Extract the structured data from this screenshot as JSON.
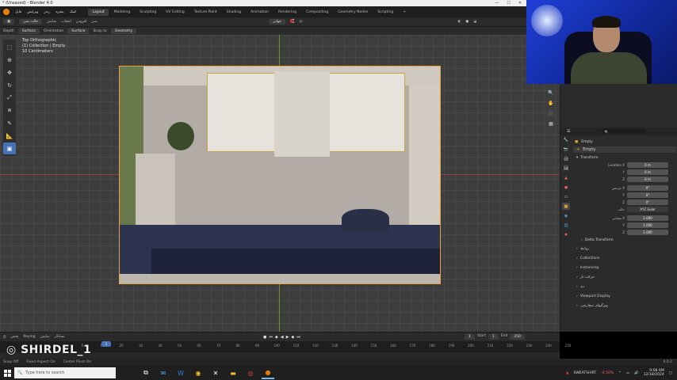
{
  "window": {
    "title": "* (Unsaved) - Blender 4.0",
    "controls": [
      "—",
      "☐",
      "✕"
    ]
  },
  "menubar": {
    "items": [
      "فایل",
      "ویرایش",
      "رندر",
      "پنجره",
      "کمک"
    ],
    "tabs": [
      "Layout",
      "Modeling",
      "Sculpting",
      "UV Editing",
      "Texture Paint",
      "Shading",
      "Animation",
      "Rendering",
      "Compositing",
      "Geometry Nodes",
      "Scripting",
      "+"
    ],
    "active_tab": "Layout"
  },
  "header": {
    "mode": "حالت شئ",
    "menus": [
      "نمایش",
      "انتخاب",
      "افزودن",
      "شئ"
    ],
    "view": "جهانی"
  },
  "tool_header": {
    "depth_label": "Depth",
    "depth_value": "Surface",
    "orientation_label": "Orientation",
    "orientation_value": "Surface",
    "snap_label": "Snap to",
    "snap_value": "Geometry"
  },
  "viewport": {
    "overlay": [
      "Top Orthographic",
      "(1) Collection | Empty",
      "10 Centimeters"
    ]
  },
  "properties": {
    "search_placeholder": "",
    "object_name": "Empty",
    "data_name": "Empty",
    "transform_label": "Transform",
    "location_label": "Location X",
    "location": [
      "0 m",
      "0 m",
      "0 m"
    ],
    "rotation_label": "چرخش X",
    "rotation": [
      "0°",
      "0°",
      "0°"
    ],
    "rotation_mode_label": "حالت",
    "rotation_mode": "XYZ Euler",
    "scale_label": "مقیاس X",
    "scale": [
      "1.000",
      "1.000",
      "1.000"
    ],
    "axis_y": "Y",
    "axis_z": "Z",
    "delta_label": "Delta Transform",
    "sections": [
      "روابط",
      "Collections",
      "Instancing",
      "حرکت تار",
      "دید",
      "Viewport Display",
      "ویژگیهای سفارشی"
    ]
  },
  "timeline": {
    "menus": [
      "پخش",
      "Keying",
      "نمایش",
      "نشانگر"
    ],
    "current_frame": "1",
    "start_label": "Start",
    "start": "1",
    "end_label": "End",
    "end": "250",
    "ticks": [
      "0",
      "10",
      "20",
      "30",
      "40",
      "50",
      "60",
      "70",
      "80",
      "90",
      "100",
      "110",
      "120",
      "130",
      "140",
      "150",
      "160",
      "170",
      "180",
      "190",
      "200",
      "210",
      "220",
      "230",
      "240",
      "250"
    ]
  },
  "statusbar": {
    "items": [
      "Snap Off",
      "Fixed Aspect On",
      "Center Pivot On"
    ],
    "version": "4.0.2"
  },
  "watermark": "SHIRDEL_1",
  "taskbar": {
    "search_placeholder": "Type here to search",
    "tray_label": "SWEATSHIRT",
    "tray_value": "-4.50%",
    "time": "9:08 AM",
    "date": "12/18/2024"
  }
}
